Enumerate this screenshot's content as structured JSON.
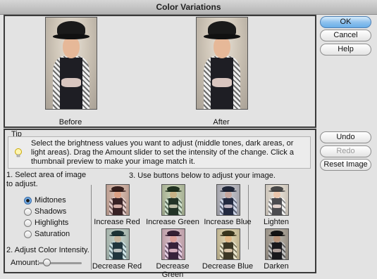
{
  "window": {
    "title": "Color Variations"
  },
  "preview": {
    "before_label": "Before",
    "after_label": "After"
  },
  "buttons": {
    "ok": "OK",
    "cancel": "Cancel",
    "help": "Help",
    "undo": "Undo",
    "redo": "Redo",
    "reset": "Reset Image"
  },
  "tip": {
    "label": "Tip",
    "text": "Select the brightness values you want to adjust (middle tones, dark areas, or light areas). Drag the Amount slider to set the intensity of the change. Click a thumbnail preview to make your image match it."
  },
  "step1": {
    "label": "1. Select area of image to adjust.",
    "options": [
      "Midtones",
      "Shadows",
      "Highlights",
      "Saturation"
    ],
    "selected": "Midtones"
  },
  "step2": {
    "label": "2. Adjust Color Intensity.",
    "amount_label": "Amount:",
    "amount_level": 0.2
  },
  "step3": {
    "label": "3. Use buttons below to adjust your image.",
    "color_variations": [
      {
        "label": "Increase Red",
        "tint": "#b13a2a"
      },
      {
        "label": "Increase Green",
        "tint": "#3d9b38"
      },
      {
        "label": "Increase Blue",
        "tint": "#3a5ec2"
      },
      {
        "label": "Decrease Red",
        "tint": "#2aa3b0"
      },
      {
        "label": "Decrease Green",
        "tint": "#b03aa8"
      },
      {
        "label": "Decrease Blue",
        "tint": "#c8b12e"
      }
    ],
    "brightness": [
      {
        "label": "Lighten",
        "tint": "#ffffff"
      },
      {
        "label": "Darken",
        "tint": "#000000"
      }
    ]
  },
  "colors": {
    "accent": "#6aaee8",
    "border": "#3a3a3a"
  }
}
